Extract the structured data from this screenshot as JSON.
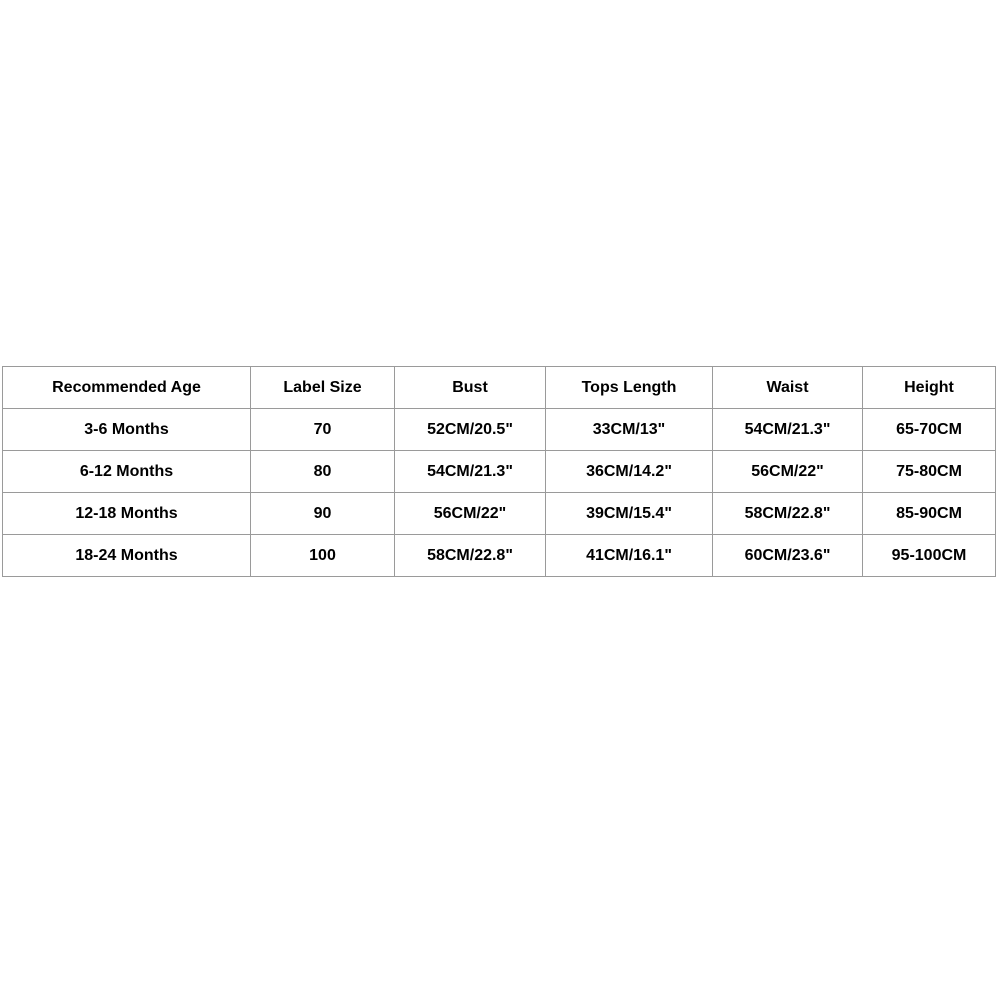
{
  "table": {
    "columns": [
      "Recommended Age",
      "Label Size",
      "Bust",
      "Tops Length",
      "Waist",
      "Height"
    ],
    "rows": [
      {
        "recommended_age": "3-6 Months",
        "label_size": "70",
        "bust": "52CM/20.5\"",
        "tops_length": "33CM/13\"",
        "waist": "54CM/21.3\"",
        "height": "65-70CM"
      },
      {
        "recommended_age": "6-12 Months",
        "label_size": "80",
        "bust": "54CM/21.3\"",
        "tops_length": "36CM/14.2\"",
        "waist": "56CM/22\"",
        "height": "75-80CM"
      },
      {
        "recommended_age": "12-18 Months",
        "label_size": "90",
        "bust": "56CM/22\"",
        "tops_length": "39CM/15.4\"",
        "waist": "58CM/22.8\"",
        "height": "85-90CM"
      },
      {
        "recommended_age": "18-24 Months",
        "label_size": "100",
        "bust": "58CM/22.8\"",
        "tops_length": "41CM/16.1\"",
        "waist": "60CM/23.6\"",
        "height": "95-100CM"
      }
    ]
  },
  "colors": {
    "background": "#ffffff",
    "border": "#9a9a9a",
    "text": "#000000"
  }
}
